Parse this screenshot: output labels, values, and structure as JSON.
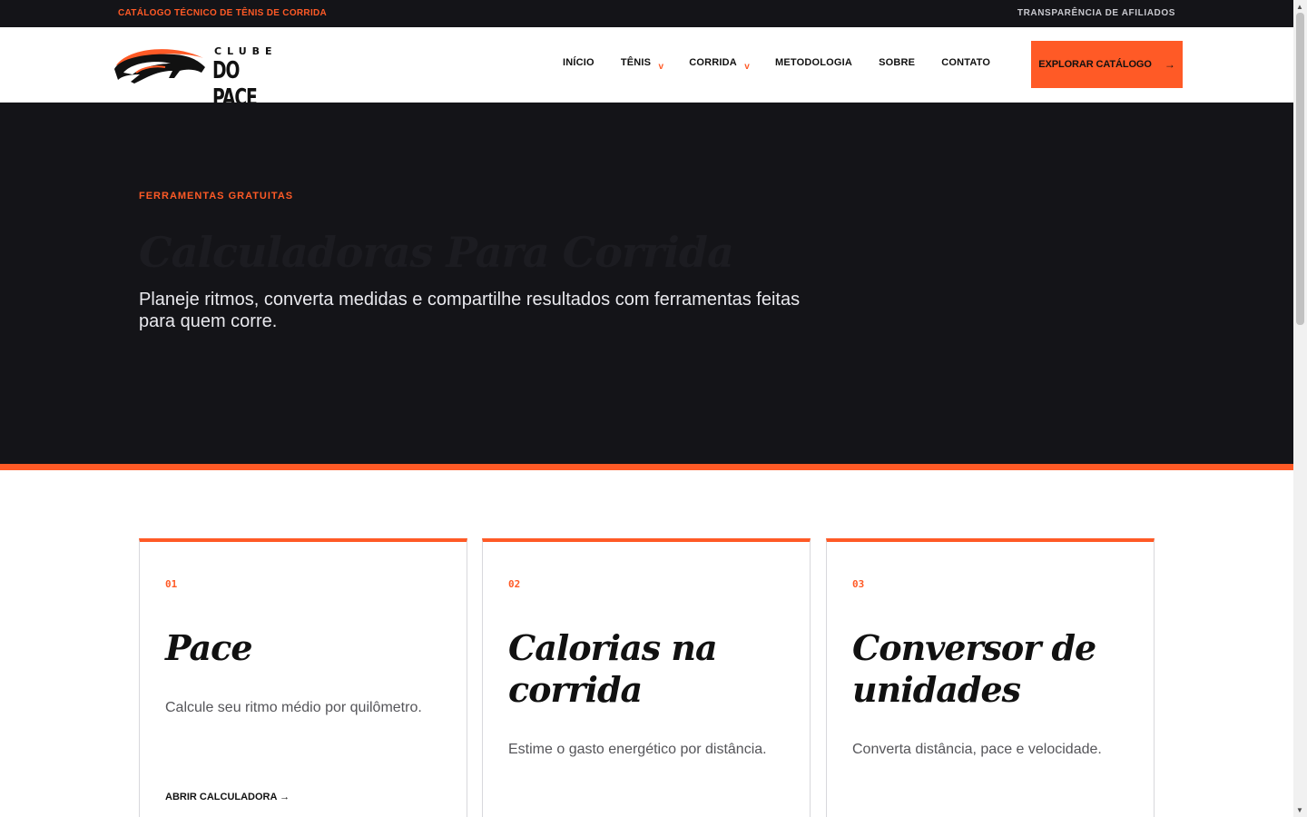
{
  "topbar": {
    "left_text": "CATÁLOGO TÉCNICO DE TÊNIS DE CORRIDA",
    "right_text": "TRANSPARÊNCIA DE AFILIADOS"
  },
  "logo": {
    "line1": "CLUBE",
    "line2": "DO PACE",
    "icon": "running-panther-icon"
  },
  "nav": {
    "items": [
      {
        "label": "INÍCIO"
      },
      {
        "label": "TÊNIS",
        "caret": "v"
      },
      {
        "label": "CORRIDA",
        "caret": "v"
      },
      {
        "label": "METODOLOGIA"
      },
      {
        "label": "SOBRE"
      },
      {
        "label": "CONTATO"
      }
    ],
    "cta_label": "EXPLORAR CATÁLOGO",
    "cta_arrow": "→"
  },
  "hero": {
    "eyebrow": "FERRAMENTAS GRATUITAS",
    "title": "Calculadoras Para Corrida",
    "subtitle": "Planeje ritmos, converta medidas e compartilhe resultados com ferramentas feitas para quem corre."
  },
  "cards": [
    {
      "num": "01",
      "title": "Pace",
      "desc": "Calcule seu ritmo médio por quilômetro.",
      "link": "ABRIR CALCULADORA →"
    },
    {
      "num": "02",
      "title": "Calorias na corrida",
      "desc": "Estime o gasto energético por distância."
    },
    {
      "num": "03",
      "title": "Conversor de unidades",
      "desc": "Converta distância, pace e velocidade."
    }
  ],
  "colors": {
    "accent": "#ff5a26",
    "dark": "#141418",
    "text": "#111111"
  }
}
